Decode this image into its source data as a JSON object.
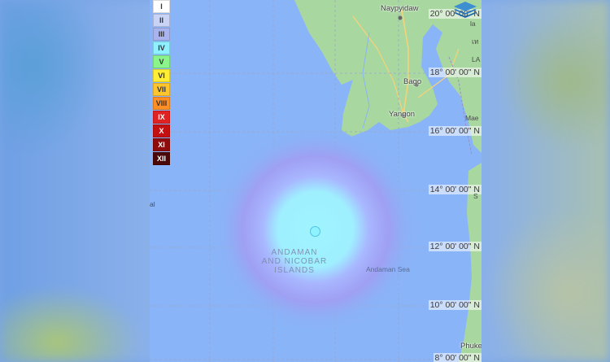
{
  "map": {
    "latitude_labels": [
      "20° 00' 00\" N",
      "18° 00' 00\" N",
      "16° 00' 00\" N",
      "14° 00' 00\" N",
      "12° 00' 00\" N",
      "10° 00' 00\" N",
      "8° 00' 00\" N"
    ],
    "places": {
      "naypyidaw": "Naypyidaw",
      "bago": "Bago",
      "yangon": "Yangon",
      "phuket": "Phuket",
      "andaman_sea": "Andaman Sea"
    },
    "region_lines": [
      "ANDAMAN",
      "AND NICOBAR",
      "ISLANDS"
    ],
    "edge_labels": {
      "left": "al",
      "right_1": "la",
      "right_2": "เท",
      "right_3": "LA",
      "right_4": "Mae",
      "right_5": "S"
    },
    "colors": {
      "water": "#8ab4f8",
      "land": "#a8d8a0",
      "accent_glow": "#9ff4ff"
    }
  },
  "legend": {
    "items": [
      {
        "label": "I",
        "bg": "#ffffff",
        "fg": "#333333"
      },
      {
        "label": "II",
        "bg": "#c9d3f5",
        "fg": "#333333"
      },
      {
        "label": "III",
        "bg": "#a9b4ee",
        "fg": "#333333"
      },
      {
        "label": "IV",
        "bg": "#8ff0ff",
        "fg": "#333333"
      },
      {
        "label": "V",
        "bg": "#8af58a",
        "fg": "#333333"
      },
      {
        "label": "VI",
        "bg": "#ffee33",
        "fg": "#333333"
      },
      {
        "label": "VII",
        "bg": "#ffc52d",
        "fg": "#333333"
      },
      {
        "label": "VIII",
        "bg": "#ff8f24",
        "fg": "#333333"
      },
      {
        "label": "IX",
        "bg": "#e02222",
        "fg": "#ffffff"
      },
      {
        "label": "X",
        "bg": "#c41010",
        "fg": "#ffffff"
      },
      {
        "label": "XI",
        "bg": "#8e0c0c",
        "fg": "#ffffff"
      },
      {
        "label": "XII",
        "bg": "#4a0808",
        "fg": "#ffffff"
      }
    ]
  },
  "controls": {
    "layers_icon": "layers-icon"
  }
}
